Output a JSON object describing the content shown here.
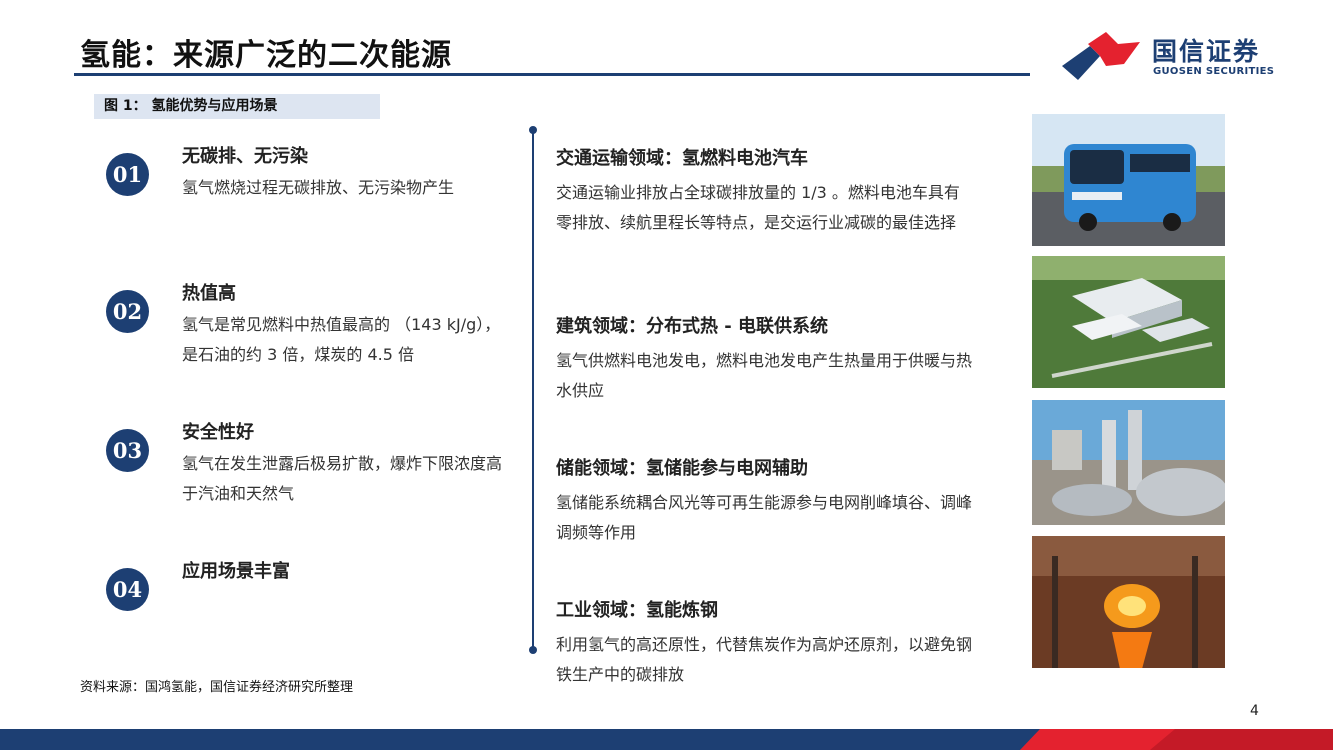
{
  "slide": {
    "title": "氢能：来源广泛的二次能源",
    "figure_label": "图 1： 氢能优势与应用场景",
    "source": "资料来源：国鸿氢能，国信证券经济研究所整理",
    "page_number": "4"
  },
  "logo": {
    "name_cn": "国信证券",
    "name_en": "GUOSEN SECURITIES",
    "colors": {
      "blue": "#1d3f73",
      "red": "#e4222f"
    }
  },
  "advantages": [
    {
      "num": "01",
      "title": "无碳排、无污染",
      "desc": "氢气燃烧过程无碳排放、无污染物产生"
    },
    {
      "num": "02",
      "title": "热值高",
      "desc": "氢气是常见燃料中热值最高的 （143 kJ/g）， 是石油的约 3 倍，煤炭的 4.5 倍"
    },
    {
      "num": "03",
      "title": "安全性好",
      "desc": "氢气在发生泄露后极易扩散，爆炸下限浓度高于汽油和天然气"
    },
    {
      "num": "04",
      "title": "应用场景丰富",
      "desc": ""
    }
  ],
  "applications": [
    {
      "title": "交通运输领域：氢燃料电池汽车",
      "desc": "交通运输业排放占全球碳排放量的 1/3 。燃料电池车具有 零排放、续航里程长等特点，是交运行业减碳的最佳选择"
    },
    {
      "title": "建筑领域：分布式热 - 电联供系统",
      "desc": "氢气供燃料电池发电，燃料电池发电产生热量用于供暖与热水供应"
    },
    {
      "title": "储能领域：氢储能参与电网辅助",
      "desc": "氢储能系统耦合风光等可再生能源参与电网削峰填谷、调峰调频等作用"
    },
    {
      "title": "工业领域：氢能炼钢",
      "desc": "利用氢气的高还原性，代替焦炭作为高炉还原剂，以避免钢铁生产中的碳排放"
    }
  ],
  "pictures": [
    "bus-photo",
    "building-aerial-photo",
    "storage-tank-photo",
    "steelmaking-photo"
  ],
  "theme": {
    "primary": "#1d3f73",
    "label_bg": "#dde5f1",
    "accent_red": "#e4222f"
  }
}
